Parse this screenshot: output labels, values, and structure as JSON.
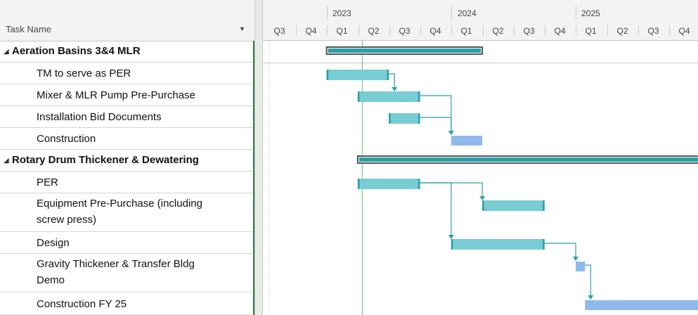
{
  "table": {
    "header": "Task Name",
    "rows": [
      {
        "name": "Aeration Basins 3&4 MLR",
        "summary": true,
        "collapse_icon": "◢"
      },
      {
        "name": "TM to serve as PER"
      },
      {
        "name": "Mixer & MLR Pump Pre-Purchase"
      },
      {
        "name": "Installation Bid Documents"
      },
      {
        "name": "Construction"
      },
      {
        "name": "Rotary Drum Thickener & Dewatering",
        "summary": true,
        "collapse_icon": "◢"
      },
      {
        "name": "PER"
      },
      {
        "name": "Equipment Pre-Purchase (including",
        "name2": "screw press)"
      },
      {
        "name": "Design"
      },
      {
        "name": "Gravity Thickener & Transfer Bldg",
        "name2": "Demo"
      },
      {
        "name": "Construction FY 25"
      }
    ]
  },
  "timescale": {
    "years": [
      "2023",
      "2024",
      "2025"
    ],
    "quarters": [
      "Q3",
      "Q4",
      "Q1",
      "Q2",
      "Q3",
      "Q4",
      "Q1",
      "Q2",
      "Q3",
      "Q4",
      "Q1",
      "Q2",
      "Q3",
      "Q4"
    ]
  },
  "colors": {
    "task_bar": "#78ccd4",
    "task_bar_edge": "#2a9fa8",
    "summary_fill": "#2a9fa8",
    "summary_outline": "#555555",
    "construction_bar": "#8fb9ea",
    "connector": "#2a9fa8",
    "today_line": "#8ccf9c"
  },
  "gantt": {
    "today_quarter": 3.15,
    "bars": [
      {
        "row": 0,
        "start": 2.0,
        "end": 7.0,
        "kind": "summary"
      },
      {
        "row": 1,
        "start": 2.0,
        "end": 4.0,
        "kind": "task"
      },
      {
        "row": 2,
        "start": 3.0,
        "end": 5.0,
        "kind": "task"
      },
      {
        "row": 3,
        "start": 4.0,
        "end": 5.0,
        "kind": "task"
      },
      {
        "row": 4,
        "start": 6.0,
        "end": 7.0,
        "kind": "construction"
      },
      {
        "row": 5,
        "start": 3.0,
        "end": 14.0,
        "kind": "summary"
      },
      {
        "row": 6,
        "start": 3.0,
        "end": 5.0,
        "kind": "task"
      },
      {
        "row": 7,
        "start": 7.0,
        "end": 9.0,
        "kind": "task"
      },
      {
        "row": 8,
        "start": 6.0,
        "end": 9.0,
        "kind": "task"
      },
      {
        "row": 9,
        "start": 10.0,
        "end": 10.3,
        "kind": "construction"
      },
      {
        "row": 10,
        "start": 10.3,
        "end": 14.0,
        "kind": "construction"
      }
    ],
    "links": [
      {
        "from": 1,
        "to": 2
      },
      {
        "from": 2,
        "to": 4
      },
      {
        "from": 3,
        "to": 4
      },
      {
        "from": 6,
        "to": 7
      },
      {
        "from": 6,
        "to": 8
      },
      {
        "from": 8,
        "to": 9
      },
      {
        "from": 9,
        "to": 10
      }
    ]
  }
}
